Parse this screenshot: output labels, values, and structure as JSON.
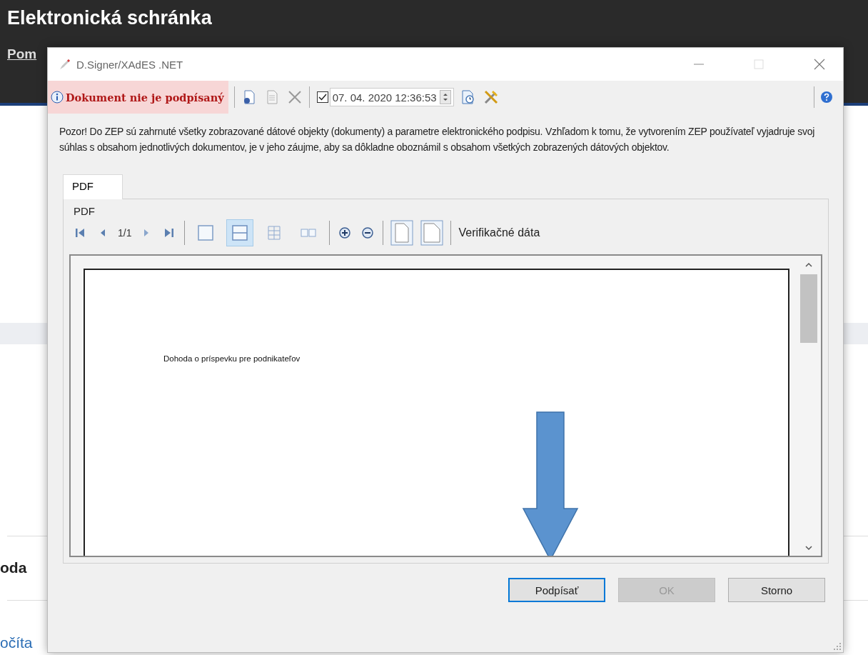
{
  "background_page": {
    "title": "Elektronická schránka",
    "nav_link": "Pom",
    "heading": "oda",
    "link": "očíta"
  },
  "dialog": {
    "title": "D.Signer/XAdES .NET",
    "status": {
      "text": "Dokument nie je podpísaný"
    },
    "timestamp": {
      "checked": true,
      "value": "07. 04. 2020 12:36:53"
    },
    "warning": "Pozor! Do ZEP sú zahrnuté všetky zobrazované dátové objekty (dokumenty) a parametre elektronického podpisu. Vzhľadom k tomu, že vytvorením ZEP používateľ vyjadruje svoj súhlas s obsahom jednotlivých dokumentov, je v jeho záujme, aby sa dôkladne oboznámil s obsahom všetkých zobrazených dátových objektov.",
    "tabs": [
      {
        "label": "PDF",
        "selected": true
      }
    ],
    "viewer": {
      "label": "PDF",
      "page": "1/1",
      "view_modes": [
        {
          "selected": false
        },
        {
          "selected": true
        },
        {
          "selected": false
        },
        {
          "selected": false
        }
      ],
      "verification": "Verifikačné dáta",
      "document_text": "Dohoda o príspevku pre podnikateľov"
    },
    "buttons": [
      {
        "label": "Podpísať",
        "disabled": false,
        "focused": true
      },
      {
        "label": "OK",
        "disabled": true,
        "focused": false
      },
      {
        "label": "Storno",
        "disabled": false,
        "focused": false
      }
    ]
  }
}
